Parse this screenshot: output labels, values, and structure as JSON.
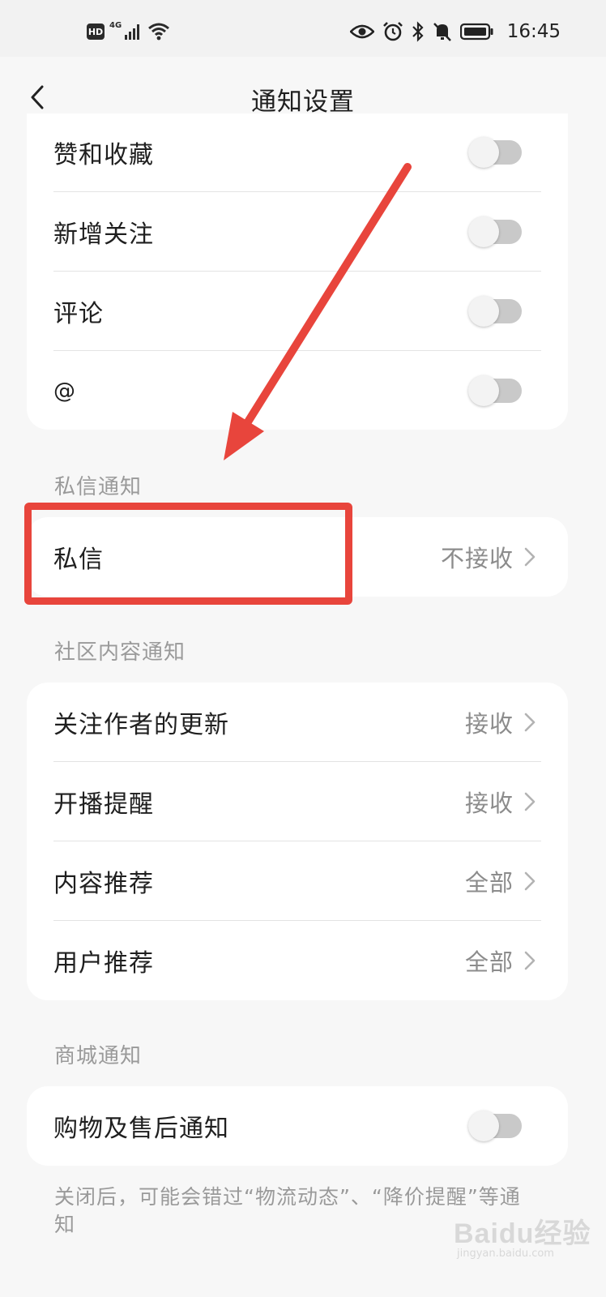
{
  "status_bar": {
    "hd": "HD",
    "network": "4G",
    "time": "16:45"
  },
  "nav": {
    "title": "通知设置"
  },
  "interaction_card": {
    "rows": [
      {
        "label": "赞和收藏",
        "toggle": false
      },
      {
        "label": "新增关注",
        "toggle": false
      },
      {
        "label": "评论",
        "toggle": false
      },
      {
        "label": "@",
        "toggle": false
      }
    ]
  },
  "private_message_section": {
    "header": "私信通知",
    "row": {
      "label": "私信",
      "value": "不接收"
    }
  },
  "community_section": {
    "header": "社区内容通知",
    "rows": [
      {
        "label": "关注作者的更新",
        "value": "接收"
      },
      {
        "label": "开播提醒",
        "value": "接收"
      },
      {
        "label": "内容推荐",
        "value": "全部"
      },
      {
        "label": "用户推荐",
        "value": "全部"
      }
    ]
  },
  "mall_section": {
    "header": "商城通知",
    "row": {
      "label": "购物及售后通知",
      "toggle": false
    },
    "footnote": "关闭后，可能会错过“物流动态”、“降价提醒”等通知"
  },
  "watermark": {
    "logo": "Baidu经验",
    "url": "jingyan.baidu.com"
  },
  "colors": {
    "annotation": "#e8453c",
    "background": "#f7f7f7",
    "card": "#ffffff",
    "secondary_text": "#8c8c8c"
  }
}
